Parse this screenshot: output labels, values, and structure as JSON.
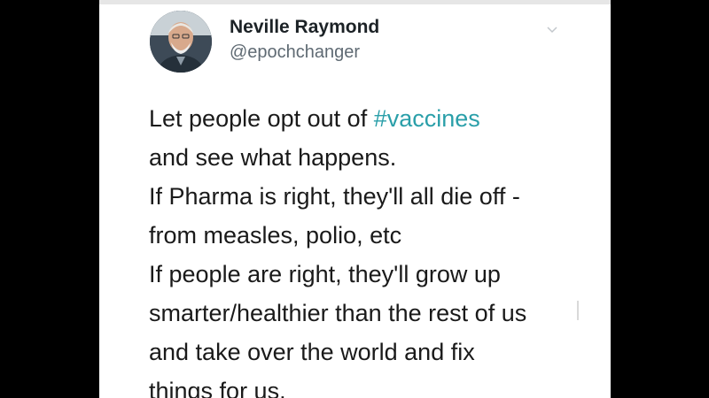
{
  "tweet": {
    "author": {
      "name": "Neville Raymond",
      "handle": "@epochchanger"
    },
    "body": {
      "line1_prefix": "Let people opt out of ",
      "line1_hashtag": "#vaccines",
      "lines": [
        "and see what happens.",
        "If Pharma is right, they'll all die off -",
        "from measles, polio, etc",
        "If people are right, they'll grow up",
        "smarter/healthier than the rest of us",
        "and take over the world and fix",
        "things for us."
      ]
    },
    "colors": {
      "background": "#000000",
      "card": "#ffffff",
      "text": "#1a1a1a",
      "handle": "#5f6a73",
      "hashtag": "#2a9fa9"
    },
    "icons": {
      "avatar": "profile-photo",
      "menu": "chevron-down-icon"
    }
  }
}
